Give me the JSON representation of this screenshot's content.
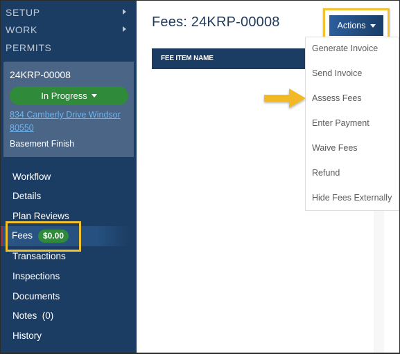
{
  "sidebar": {
    "top_nav": [
      {
        "label": "SETUP",
        "has_submenu": true
      },
      {
        "label": "WORK",
        "has_submenu": true
      },
      {
        "label": "PERMITS",
        "has_submenu": false
      }
    ],
    "record": {
      "id": "24KRP-00008",
      "status": "In Progress",
      "address": "834 Camberly Drive Windsor 80550",
      "description": "Basement Finish"
    },
    "items": [
      {
        "label": "Workflow"
      },
      {
        "label": "Details"
      },
      {
        "label": "Plan Reviews"
      },
      {
        "label": "Fees",
        "badge": "$0.00",
        "active": true
      },
      {
        "label": "Transactions"
      },
      {
        "label": "Inspections"
      },
      {
        "label": "Documents"
      },
      {
        "label": "Notes  (0)"
      },
      {
        "label": "History"
      }
    ]
  },
  "main": {
    "title": "Fees: 24KRP-00008",
    "actions_label": "Actions",
    "table": {
      "columns": [
        "FEE ITEM NAME"
      ]
    },
    "actions_menu": [
      "Generate Invoice",
      "Send Invoice",
      "Assess Fees",
      "Enter Payment",
      "Waive Fees",
      "Refund",
      "Hide Fees Externally"
    ]
  },
  "annotations": {
    "highlight_color": "#f2c12e",
    "arrow_target": "Assess Fees"
  },
  "colors": {
    "sidebar_bg": "#1c3d63",
    "status_green": "#2f8a3a",
    "link_blue": "#6eb4ef",
    "title_navy": "#1f3a5c"
  }
}
